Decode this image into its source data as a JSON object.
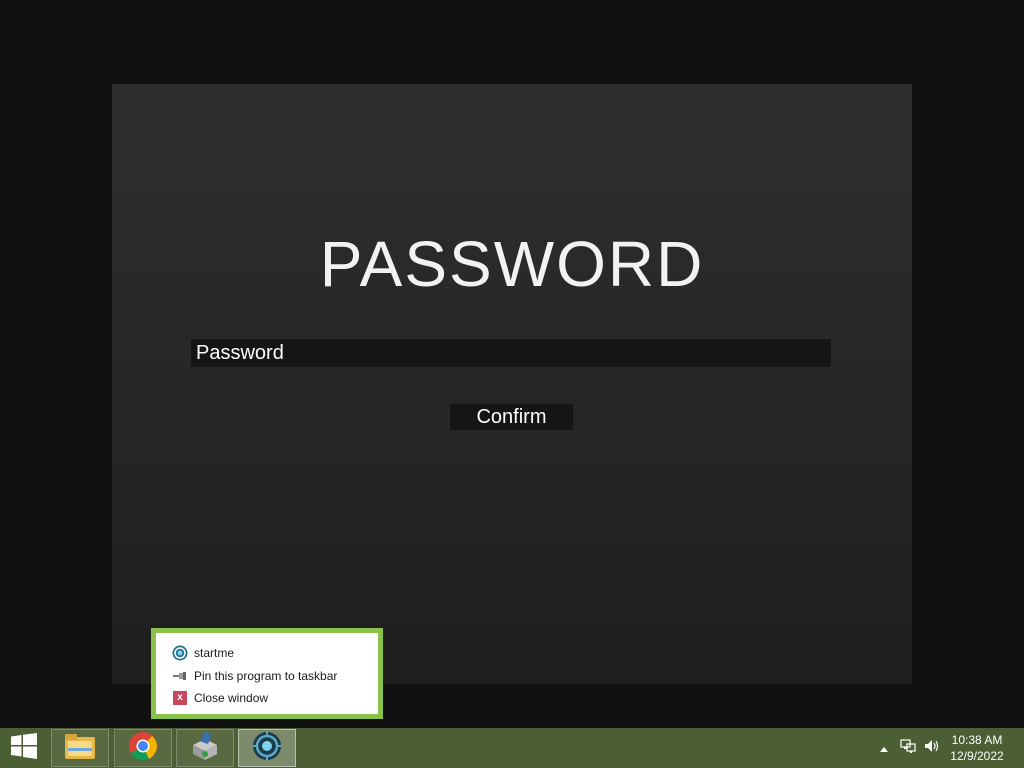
{
  "app": {
    "title": "PASSWORD",
    "password_placeholder": "Password",
    "confirm_label": "Confirm"
  },
  "jump_list": {
    "items": [
      {
        "label": "startme",
        "icon": "startme-app-icon"
      },
      {
        "label": "Pin this program to taskbar",
        "icon": "pin-icon"
      },
      {
        "label": "Close window",
        "icon": "close-icon"
      }
    ],
    "border_color": "#8bc34a"
  },
  "taskbar": {
    "color": "#4b5e34",
    "pinned": [
      {
        "name": "file-explorer",
        "icon": "folder-icon"
      },
      {
        "name": "chrome",
        "icon": "chrome-icon"
      },
      {
        "name": "installer",
        "icon": "installer-icon"
      },
      {
        "name": "startme",
        "icon": "startme-app-icon",
        "active": true
      }
    ],
    "clock": {
      "time": "10:38 AM",
      "date": "12/9/2022"
    }
  }
}
